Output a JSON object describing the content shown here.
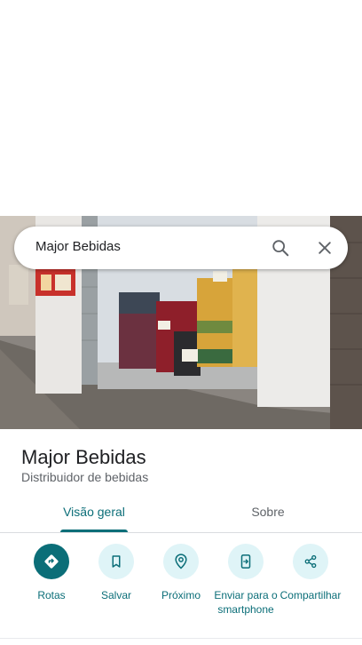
{
  "search": {
    "query": "Major Bebidas",
    "search_icon": "search-icon",
    "close_icon": "close-icon"
  },
  "place": {
    "name": "Major Bebidas",
    "category": "Distribuidor de bebidas",
    "photo_subject": "storefront-photo"
  },
  "tabs": [
    {
      "label": "Visão geral",
      "selected": true
    },
    {
      "label": "Sobre",
      "selected": false
    }
  ],
  "actions": [
    {
      "label": "Rotas",
      "icon": "directions-icon",
      "primary": true
    },
    {
      "label": "Salvar",
      "icon": "bookmark-icon",
      "primary": false
    },
    {
      "label": "Próximo",
      "icon": "nearby-icon",
      "primary": false
    },
    {
      "label": "Enviar para o smartphone",
      "icon": "send-to-phone-icon",
      "primary": false
    },
    {
      "label": "Compartilhar",
      "icon": "share-icon",
      "primary": false
    }
  ],
  "colors": {
    "accent": "#0b6e78",
    "action_bg": "#dff4f7",
    "text_primary": "#202124",
    "text_secondary": "#5f6368"
  }
}
